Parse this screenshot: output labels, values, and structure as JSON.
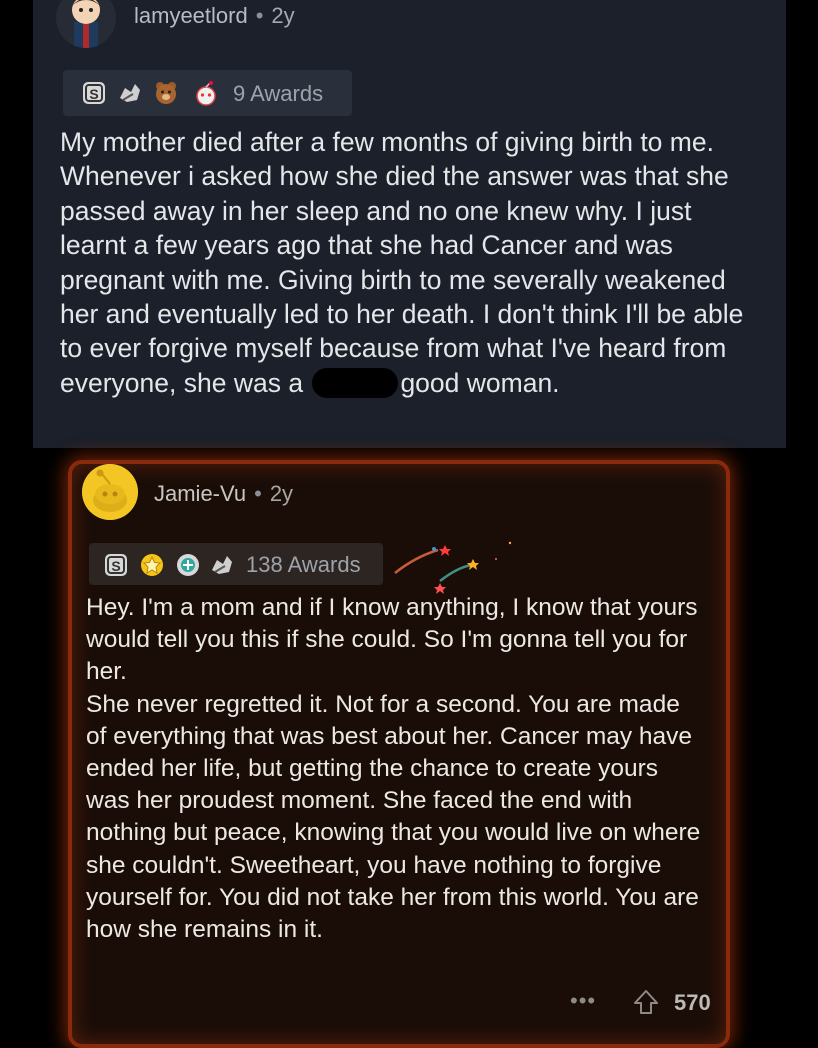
{
  "comment1": {
    "username": "lamyeetlord",
    "separator": "•",
    "age": "2y",
    "awards_label": "9 Awards",
    "award_icons": [
      "silver-award-icon",
      "wholesome-seal-award-icon",
      "bear-award-icon",
      "snoo-award-icon"
    ],
    "body_before_redaction": "My mother died after a few months of giving birth to me. Whenever i asked how she died the answer was that she passed away in her sleep and no one knew why. I just learnt a few years ago that she had Cancer and was pregnant with me. Giving birth to me severally weakened her and eventually led to her death. I don't think I'll be able to ever forgive myself because from what I've heard from everyone, she was a",
    "body_after_redaction": "good woman."
  },
  "comment2": {
    "username": "Jamie-Vu",
    "separator": "•",
    "age": "2y",
    "awards_label": "138 Awards",
    "award_icons": [
      "silver-award-icon",
      "gold-award-icon",
      "platinum-award-icon",
      "wholesome-seal-award-icon"
    ],
    "body": "Hey. I'm a mom and if I know anything, I know that yours would tell you this if she could. So I'm gonna tell you for her.\nShe never regretted it. Not for a second. You are made of everything that was best about her. Cancer may have ended her life, but getting the chance to create yours was her proudest moment. She faced the end with nothing but peace, knowing that you would live on where she couldn't. Sweetheart, you have nothing to forgive yourself for.  You did not take her from this world. You are how she remains in it.",
    "more_label": "•••",
    "score": "570",
    "highlight_color": "#d1400e"
  }
}
